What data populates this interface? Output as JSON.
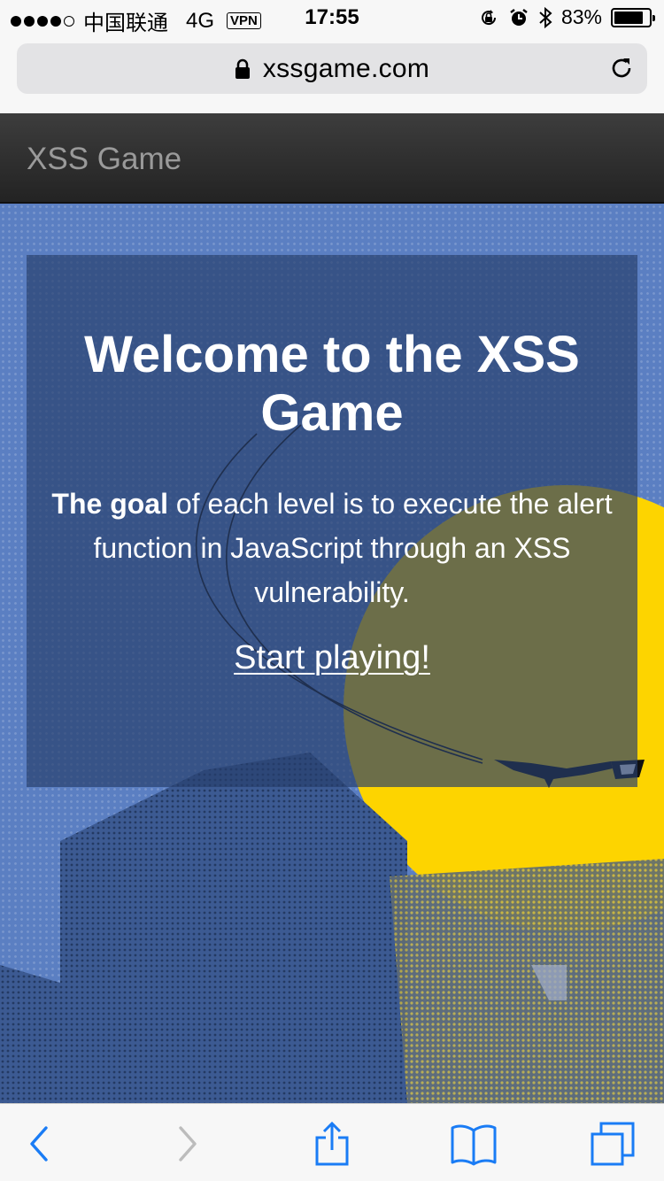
{
  "status_bar": {
    "carrier": "中国联通",
    "network": "4G",
    "vpn": "VPN",
    "time": "17:55",
    "battery_percent": "83%",
    "battery_level": 0.83,
    "icons": [
      "signal-dots",
      "rotation-lock-icon",
      "alarm-icon",
      "bluetooth-icon",
      "battery-icon"
    ]
  },
  "browser": {
    "url": "xssgame.com",
    "secure": true,
    "icons": [
      "lock-icon",
      "reload-icon"
    ]
  },
  "site_header": {
    "title": "XSS Game"
  },
  "hero": {
    "heading": "Welcome to the XSS Game",
    "goal_bold": "The goal",
    "goal_text": " of each level is to execute the alert function in JavaScript through an XSS vulnerability.",
    "start_link": "Start playing!"
  },
  "toolbar": {
    "buttons": [
      "back-icon",
      "forward-icon",
      "share-icon",
      "bookmarks-icon",
      "tabs-icon"
    ],
    "accent_color": "#1a7cf5",
    "disabled_color": "#bcbcbc"
  },
  "colors": {
    "hero_blue": "#5b7fc2",
    "moon_yellow": "#fdd400",
    "panel": "rgba(38,62,108,0.68)"
  }
}
